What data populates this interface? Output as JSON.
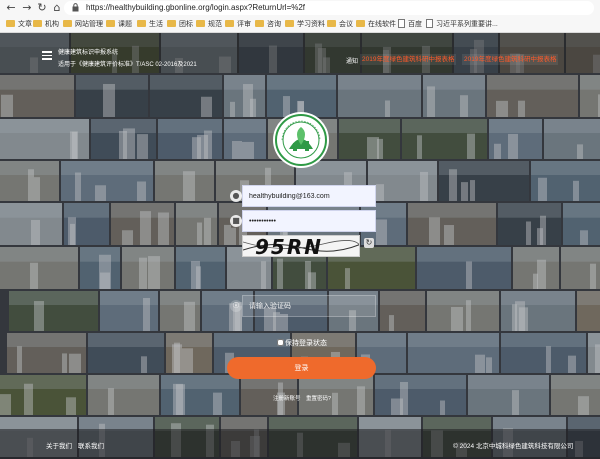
{
  "browser": {
    "url": "https://healthybuilding.gbonline.org/login.aspx?ReturnUrl=%2f",
    "bookmarks": [
      "文章",
      "机构",
      "网站管理",
      "课题",
      "生活",
      "团标",
      "规范",
      "评审",
      "咨询",
      "学习资料",
      "会议",
      "在线软件",
      "百度",
      "习近平系列重要讲..."
    ]
  },
  "header": {
    "site_name": "健康建筑标识申报系统",
    "standard": "适用于《健康建筑评价标准》T/ASC 02-2016及2021",
    "notice_label": "通知",
    "notices": [
      "2019年度绿色建筑科研中报表格",
      "2019年度绿色建筑科研中报表格"
    ]
  },
  "login": {
    "username_value": "healthybuilding@163.com",
    "password_value": "•••••••••••",
    "captcha_text": "95RN",
    "code_placeholder": "请输入验证码",
    "remember_label": "保持登录状态",
    "submit_label": "登录",
    "register_link": "注册新账号",
    "forgot_link": "重置密码?"
  },
  "footer": {
    "about": "关于我们",
    "contact": "联系我们",
    "copyright": "© 2024 北京中城科绿色建筑科技有限公司"
  },
  "colors": {
    "accent": "#ef6a2c",
    "notice": "#ff5a2a",
    "logo_green": "#2f9a46"
  }
}
